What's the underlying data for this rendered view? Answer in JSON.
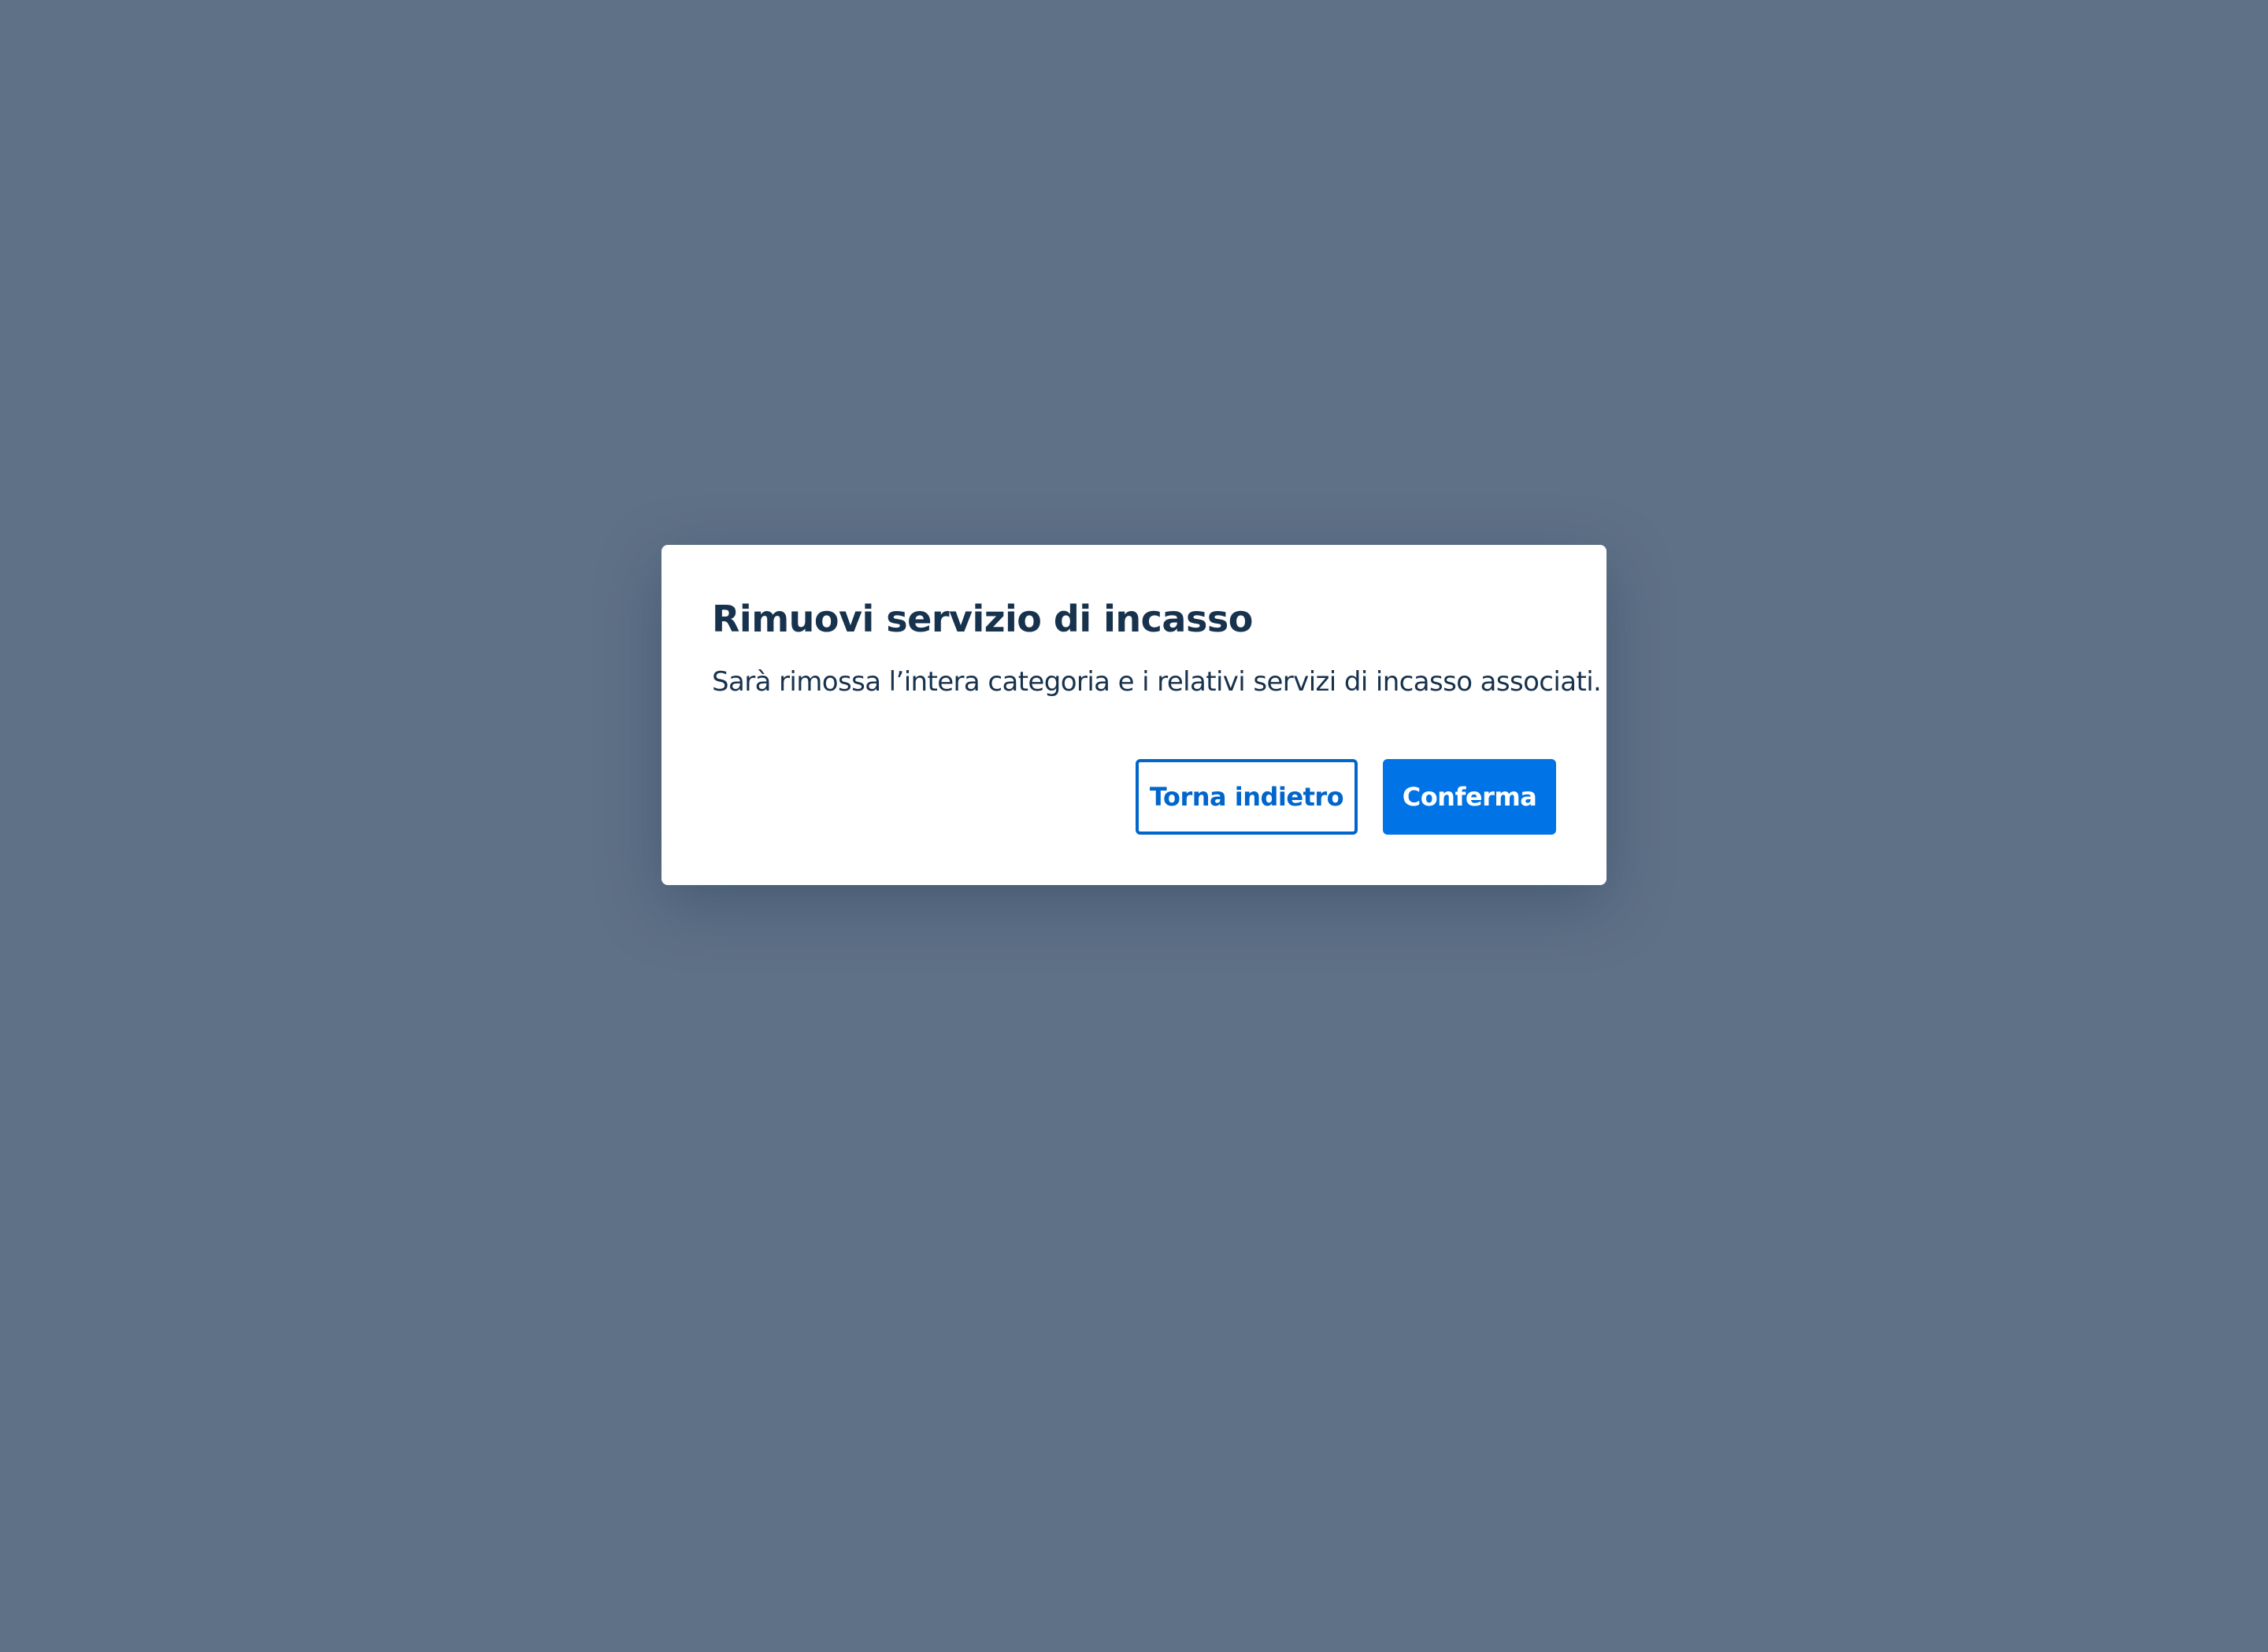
{
  "dialog": {
    "title": "Rimuovi servizio di incasso",
    "message": "Sarà rimossa l’intera categoria e i relativi servizi di incasso associati.",
    "cancel_label": "Torna indietro",
    "confirm_label": "Conferma"
  },
  "colors": {
    "backdrop": "#5f7187",
    "text": "#17324d",
    "primary": "#0073e6",
    "outline": "#0066cc"
  }
}
